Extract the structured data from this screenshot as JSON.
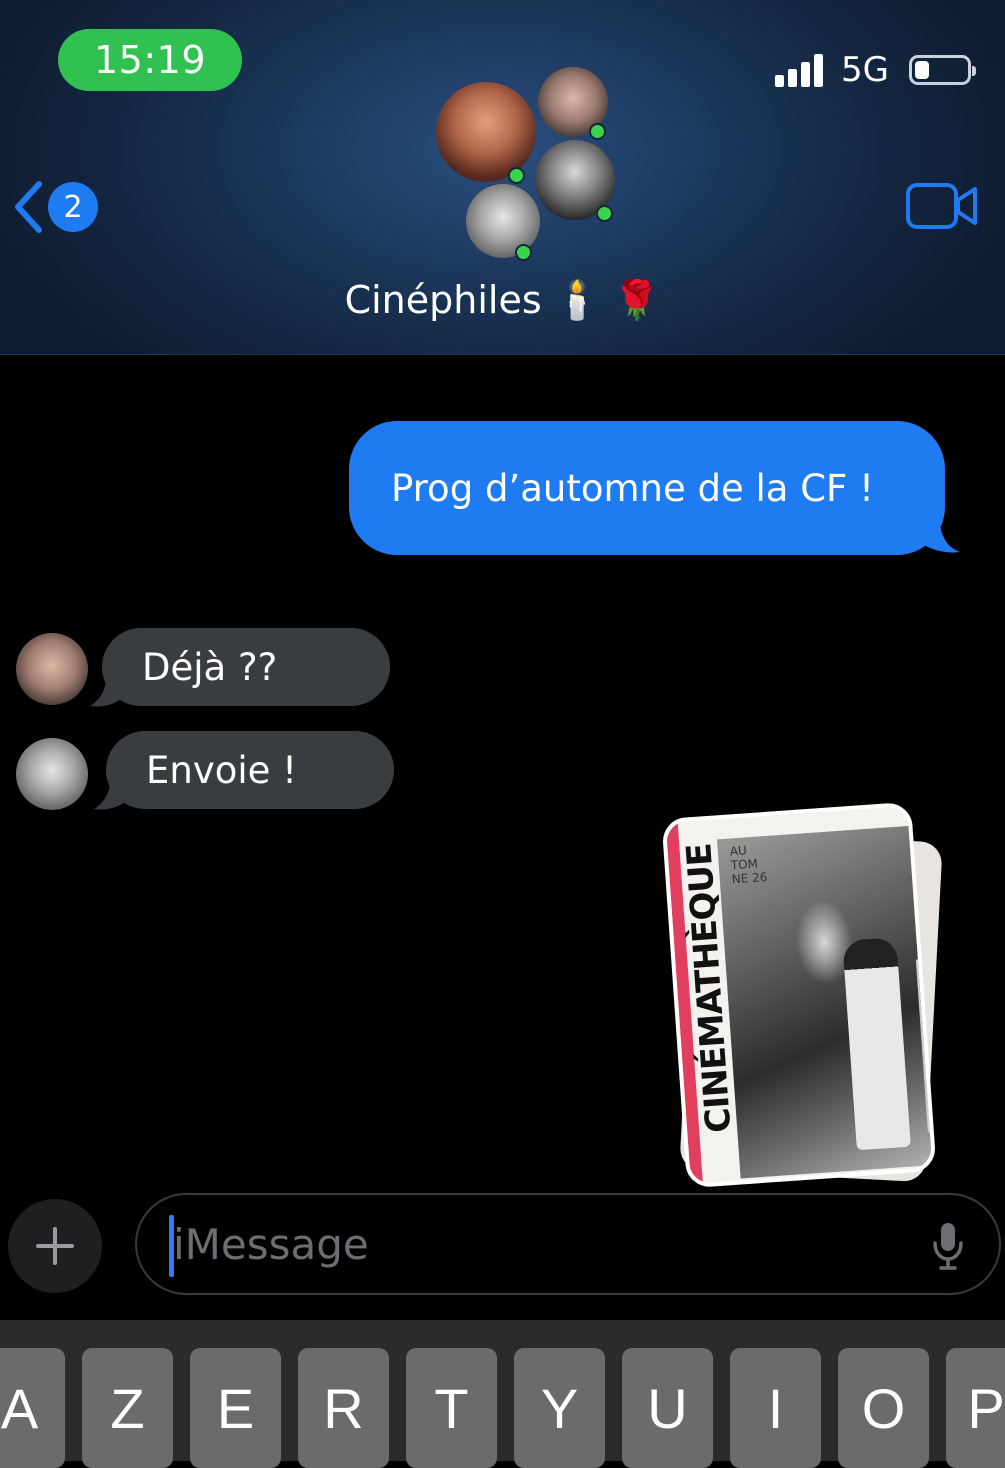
{
  "status_bar": {
    "time": "15:19",
    "network": "5G",
    "battery_level": 0.2
  },
  "header": {
    "back_badge": "2",
    "group_name": "Cinéphiles 🕯️ 🌹",
    "video_icon": "video-camera-icon",
    "back_icon": "chevron-left-icon"
  },
  "messages": {
    "outgoing_1": "Prog d’automne de la CF !",
    "incoming_1": "Déjà ??",
    "incoming_2": "Envoie !"
  },
  "sticker": {
    "title": "CINÉMATHÈQUE",
    "season": "AU TOM NE 26"
  },
  "composer": {
    "placeholder": "iMessage",
    "plus_icon": "plus-icon",
    "mic_icon": "microphone-icon"
  },
  "keyboard": {
    "row1": [
      "A",
      "Z",
      "E",
      "R",
      "T",
      "Y",
      "U",
      "I",
      "O",
      "P"
    ]
  },
  "colors": {
    "accent": "#1f7bf2",
    "time_pill": "#31c150",
    "incoming_bubble": "#3a3d40",
    "presence": "#3bd34a"
  }
}
